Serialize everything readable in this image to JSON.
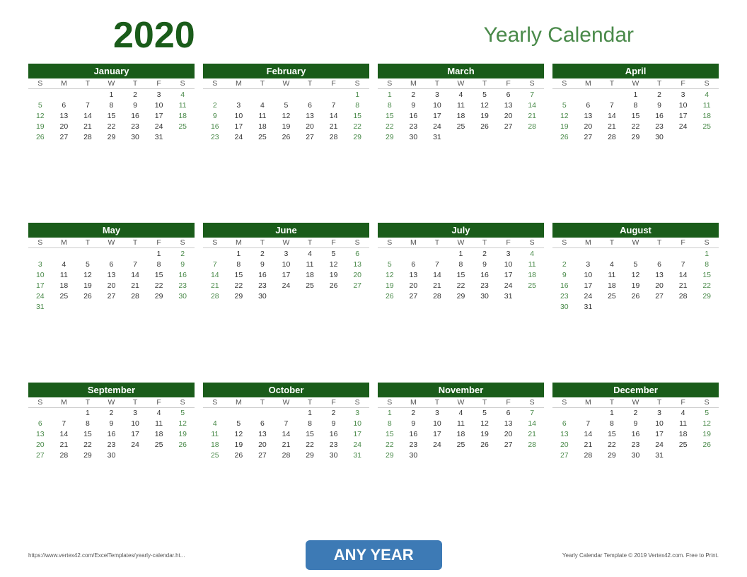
{
  "header": {
    "year": "2020",
    "title": "Yearly Calendar"
  },
  "footer": {
    "left_url": "https://www.vertex42.com/ExcelTemplates/yearly-calendar.ht...",
    "banner": "ANY YEAR",
    "right_text": "Yearly Calendar Template © 2019 Vertex42.com. Free to Print."
  },
  "months": [
    {
      "name": "January",
      "days": [
        [
          "",
          "",
          "",
          "1",
          "2",
          "3",
          "4"
        ],
        [
          "5",
          "6",
          "7",
          "8",
          "9",
          "10",
          "11"
        ],
        [
          "12",
          "13",
          "14",
          "15",
          "16",
          "17",
          "18"
        ],
        [
          "19",
          "20",
          "21",
          "22",
          "23",
          "24",
          "25"
        ],
        [
          "26",
          "27",
          "28",
          "29",
          "30",
          "31",
          ""
        ]
      ]
    },
    {
      "name": "February",
      "days": [
        [
          "",
          "",
          "",
          "",
          "",
          "",
          "1"
        ],
        [
          "2",
          "3",
          "4",
          "5",
          "6",
          "7",
          "8"
        ],
        [
          "9",
          "10",
          "11",
          "12",
          "13",
          "14",
          "15"
        ],
        [
          "16",
          "17",
          "18",
          "19",
          "20",
          "21",
          "22"
        ],
        [
          "23",
          "24",
          "25",
          "26",
          "27",
          "28",
          "29"
        ]
      ]
    },
    {
      "name": "March",
      "days": [
        [
          "1",
          "2",
          "3",
          "4",
          "5",
          "6",
          "7"
        ],
        [
          "8",
          "9",
          "10",
          "11",
          "12",
          "13",
          "14"
        ],
        [
          "15",
          "16",
          "17",
          "18",
          "19",
          "20",
          "21"
        ],
        [
          "22",
          "23",
          "24",
          "25",
          "26",
          "27",
          "28"
        ],
        [
          "29",
          "30",
          "31",
          "",
          "",
          "",
          ""
        ]
      ]
    },
    {
      "name": "April",
      "days": [
        [
          "",
          "",
          "",
          "1",
          "2",
          "3",
          "4"
        ],
        [
          "5",
          "6",
          "7",
          "8",
          "9",
          "10",
          "11"
        ],
        [
          "12",
          "13",
          "14",
          "15",
          "16",
          "17",
          "18"
        ],
        [
          "19",
          "20",
          "21",
          "22",
          "23",
          "24",
          "25"
        ],
        [
          "26",
          "27",
          "28",
          "29",
          "30",
          "",
          ""
        ]
      ]
    },
    {
      "name": "May",
      "days": [
        [
          "",
          "",
          "",
          "",
          "",
          "1",
          "2"
        ],
        [
          "3",
          "4",
          "5",
          "6",
          "7",
          "8",
          "9"
        ],
        [
          "10",
          "11",
          "12",
          "13",
          "14",
          "15",
          "16"
        ],
        [
          "17",
          "18",
          "19",
          "20",
          "21",
          "22",
          "23"
        ],
        [
          "24",
          "25",
          "26",
          "27",
          "28",
          "29",
          "30"
        ],
        [
          "31",
          "",
          "",
          "",
          "",
          "",
          ""
        ]
      ]
    },
    {
      "name": "June",
      "days": [
        [
          "",
          "1",
          "2",
          "3",
          "4",
          "5",
          "6"
        ],
        [
          "7",
          "8",
          "9",
          "10",
          "11",
          "12",
          "13"
        ],
        [
          "14",
          "15",
          "16",
          "17",
          "18",
          "19",
          "20"
        ],
        [
          "21",
          "22",
          "23",
          "24",
          "25",
          "26",
          "27"
        ],
        [
          "28",
          "29",
          "30",
          "",
          "",
          "",
          ""
        ]
      ]
    },
    {
      "name": "July",
      "days": [
        [
          "",
          "",
          "",
          "1",
          "2",
          "3",
          "4"
        ],
        [
          "5",
          "6",
          "7",
          "8",
          "9",
          "10",
          "11"
        ],
        [
          "12",
          "13",
          "14",
          "15",
          "16",
          "17",
          "18"
        ],
        [
          "19",
          "20",
          "21",
          "22",
          "23",
          "24",
          "25"
        ],
        [
          "26",
          "27",
          "28",
          "29",
          "30",
          "31",
          ""
        ]
      ]
    },
    {
      "name": "August",
      "days": [
        [
          "",
          "",
          "",
          "",
          "",
          "",
          "1"
        ],
        [
          "2",
          "3",
          "4",
          "5",
          "6",
          "7",
          "8"
        ],
        [
          "9",
          "10",
          "11",
          "12",
          "13",
          "14",
          "15"
        ],
        [
          "16",
          "17",
          "18",
          "19",
          "20",
          "21",
          "22"
        ],
        [
          "23",
          "24",
          "25",
          "26",
          "27",
          "28",
          "29"
        ],
        [
          "30",
          "31",
          "",
          "",
          "",
          "",
          ""
        ]
      ]
    },
    {
      "name": "September",
      "days": [
        [
          "",
          "",
          "1",
          "2",
          "3",
          "4",
          "5"
        ],
        [
          "6",
          "7",
          "8",
          "9",
          "10",
          "11",
          "12"
        ],
        [
          "13",
          "14",
          "15",
          "16",
          "17",
          "18",
          "19"
        ],
        [
          "20",
          "21",
          "22",
          "23",
          "24",
          "25",
          "26"
        ],
        [
          "27",
          "28",
          "29",
          "30",
          "",
          "",
          ""
        ]
      ]
    },
    {
      "name": "October",
      "days": [
        [
          "",
          "",
          "",
          "",
          "1",
          "2",
          "3"
        ],
        [
          "4",
          "5",
          "6",
          "7",
          "8",
          "9",
          "10"
        ],
        [
          "11",
          "12",
          "13",
          "14",
          "15",
          "16",
          "17"
        ],
        [
          "18",
          "19",
          "20",
          "21",
          "22",
          "23",
          "24"
        ],
        [
          "25",
          "26",
          "27",
          "28",
          "29",
          "30",
          "31"
        ]
      ]
    },
    {
      "name": "November",
      "days": [
        [
          "1",
          "2",
          "3",
          "4",
          "5",
          "6",
          "7"
        ],
        [
          "8",
          "9",
          "10",
          "11",
          "12",
          "13",
          "14"
        ],
        [
          "15",
          "16",
          "17",
          "18",
          "19",
          "20",
          "21"
        ],
        [
          "22",
          "23",
          "24",
          "25",
          "26",
          "27",
          "28"
        ],
        [
          "29",
          "30",
          "",
          "",
          "",
          "",
          ""
        ]
      ]
    },
    {
      "name": "December",
      "days": [
        [
          "",
          "",
          "1",
          "2",
          "3",
          "4",
          "5"
        ],
        [
          "6",
          "7",
          "8",
          "9",
          "10",
          "11",
          "12"
        ],
        [
          "13",
          "14",
          "15",
          "16",
          "17",
          "18",
          "19"
        ],
        [
          "20",
          "21",
          "22",
          "23",
          "24",
          "25",
          "26"
        ],
        [
          "27",
          "28",
          "29",
          "30",
          "31",
          "",
          ""
        ]
      ]
    }
  ],
  "day_headers": [
    "S",
    "M",
    "T",
    "W",
    "T",
    "F",
    "S"
  ]
}
